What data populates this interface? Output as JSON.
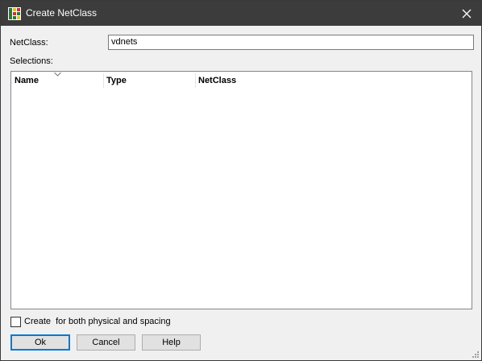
{
  "window": {
    "title": "Create NetClass"
  },
  "form": {
    "netclass_label": "NetClass:",
    "netclass_value": "vdnets",
    "selections_label": "Selections:"
  },
  "table": {
    "columns": [
      "Name",
      "Type",
      "NetClass"
    ],
    "rows": []
  },
  "options": {
    "create_both_label": "Create  for both physical and spacing",
    "create_both_checked": false
  },
  "buttons": {
    "ok": "Ok",
    "cancel": "Cancel",
    "help": "Help"
  },
  "colors": {
    "titlebar": "#3c3c3c",
    "accent": "#0078d7"
  },
  "icons": {
    "app": "netclass-app-icon",
    "close": "close-icon",
    "sort": "sort-chevron-icon",
    "resize": "resize-grip-icon"
  }
}
